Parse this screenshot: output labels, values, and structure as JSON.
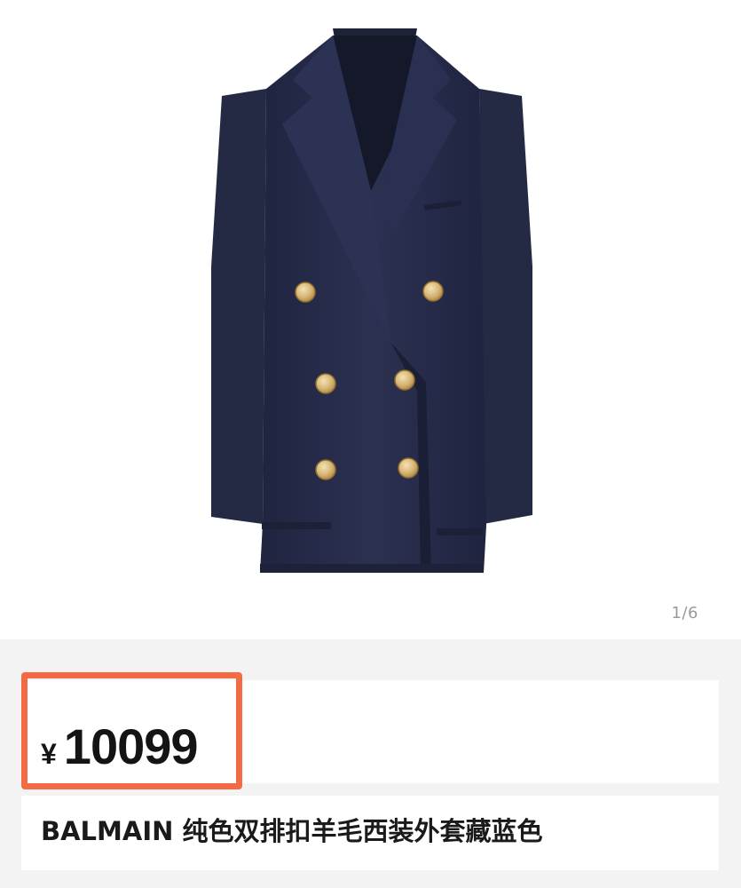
{
  "gallery": {
    "page_indicator": "1/6",
    "image_icon": "navy-double-breasted-blazer-photo"
  },
  "price": {
    "currency": "¥",
    "amount": "10099"
  },
  "product": {
    "title": "BALMAIN 纯色双排扣羊毛西装外套藏蓝色"
  },
  "colors": {
    "highlight": "#f26b44",
    "blazer": "#252a44",
    "buttons": "#d6b473",
    "panel_bg": "#f3f3f3"
  }
}
